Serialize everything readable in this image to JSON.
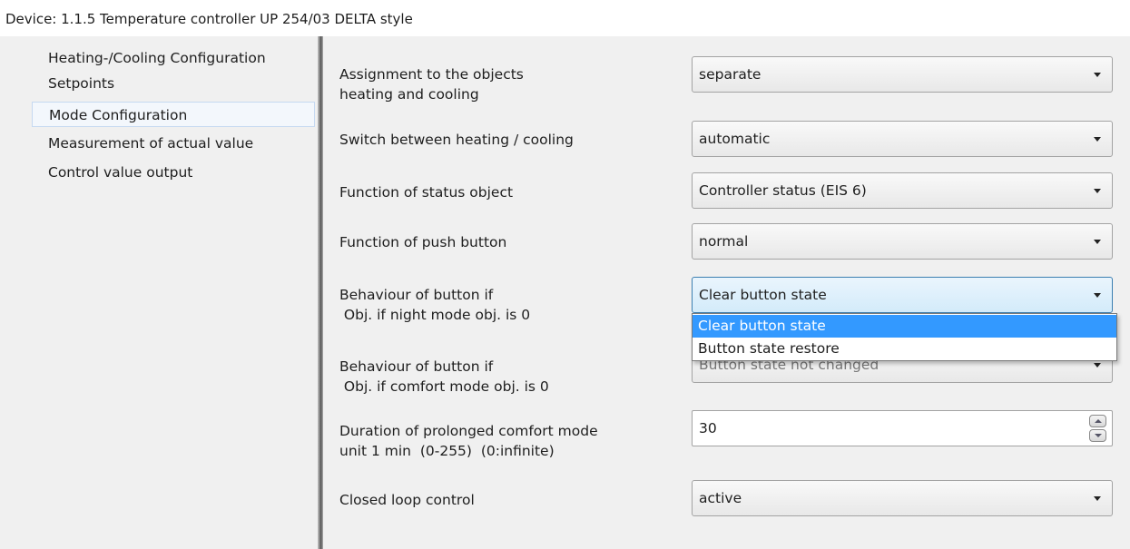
{
  "window": {
    "title": "Device: 1.1.5  Temperature controller UP 254/03 DELTA style"
  },
  "sidebar": {
    "items": [
      {
        "label": "Heating-/Cooling  Configuration"
      },
      {
        "label": "Setpoints"
      },
      {
        "label": "Mode  Configuration",
        "selected": true
      },
      {
        "label": "Measurement of actual value"
      },
      {
        "label": "Control value output"
      }
    ]
  },
  "params": [
    {
      "label_lines": [
        "Assignment to the objects",
        "heating and cooling"
      ],
      "control": "combo",
      "value": "separate"
    },
    {
      "label_lines": [
        "Switch between heating / cooling"
      ],
      "control": "combo",
      "value": "automatic"
    },
    {
      "label_lines": [
        "Function of status object"
      ],
      "control": "combo",
      "value": "Controller status (EIS 6)"
    },
    {
      "label_lines": [
        "Function of push button"
      ],
      "control": "combo",
      "value": "normal"
    },
    {
      "label_lines": [
        "Behaviour of button if",
        " Obj. if night mode obj. is 0"
      ],
      "control": "combo",
      "value": "Clear button state",
      "focused": true
    },
    {
      "label_lines": [
        "Behaviour of button if",
        " Obj. if comfort mode obj. is 0"
      ],
      "control": "combo",
      "value": "Button state not changed"
    },
    {
      "label_lines": [
        "Duration of prolonged comfort mode",
        "unit 1 min  (0-255)  (0:infinite)"
      ],
      "control": "spin",
      "value": "30"
    },
    {
      "label_lines": [
        "Closed loop control"
      ],
      "control": "combo",
      "value": "active"
    }
  ],
  "dropdown": {
    "options": [
      "Clear button state",
      "Button state restore"
    ],
    "highlighted_index": 0
  },
  "colors": {
    "panel_bg": "#f0f0f0",
    "highlight": "#3399ff",
    "focus_border": "#3c7fb1"
  }
}
